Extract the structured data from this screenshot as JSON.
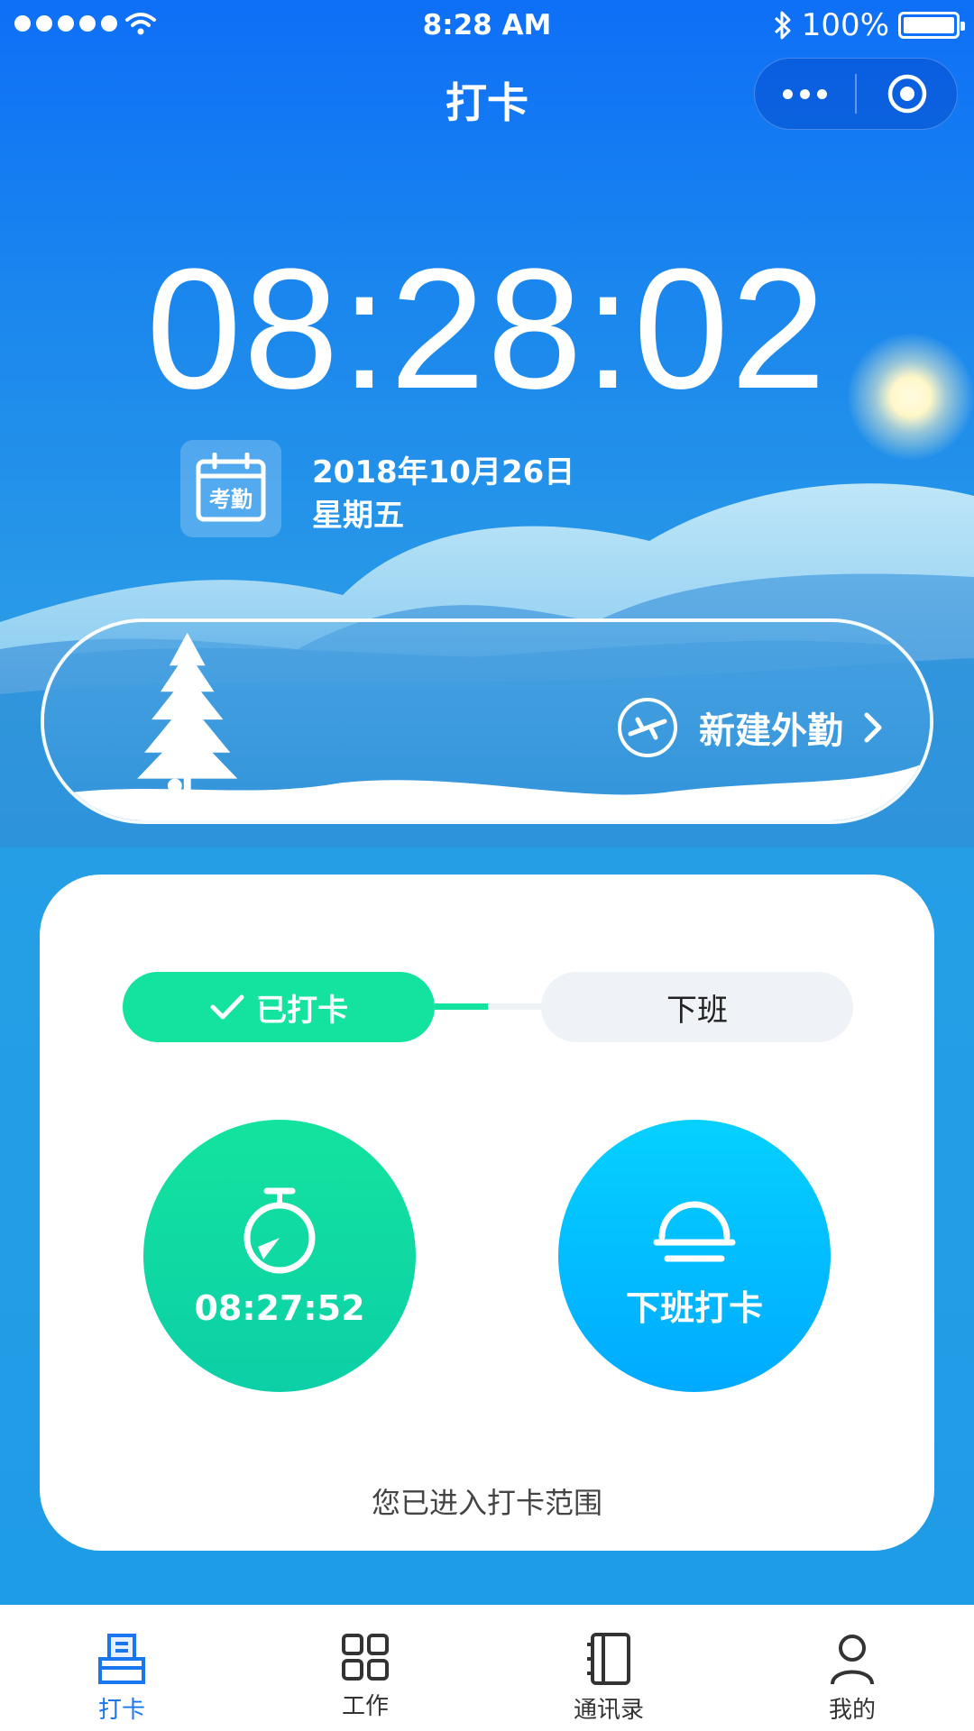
{
  "status_bar": {
    "time": "8:28 AM",
    "battery": "100%"
  },
  "nav": {
    "title": "打卡"
  },
  "clock": {
    "time": "08:28:02",
    "calendar_badge": "考勤",
    "date": "2018年10月26日",
    "weekday": "星期五"
  },
  "banner": {
    "label": "新建外勤"
  },
  "punch": {
    "done_label": "已打卡",
    "off_label": "下班",
    "progress": 0.5,
    "checkin_time": "08:27:52",
    "checkout_label": "下班打卡",
    "range_tip": "您已进入打卡范围"
  },
  "tabs": [
    {
      "label": "打卡",
      "icon": "punch-card-icon",
      "active": true
    },
    {
      "label": "工作",
      "icon": "grid-icon",
      "active": false
    },
    {
      "label": "通讯录",
      "icon": "contacts-book-icon",
      "active": false
    },
    {
      "label": "我的",
      "icon": "user-icon",
      "active": false
    }
  ],
  "colors": {
    "active": "#1a76ee",
    "green": "#13e39e",
    "blue": "#00aaff"
  }
}
